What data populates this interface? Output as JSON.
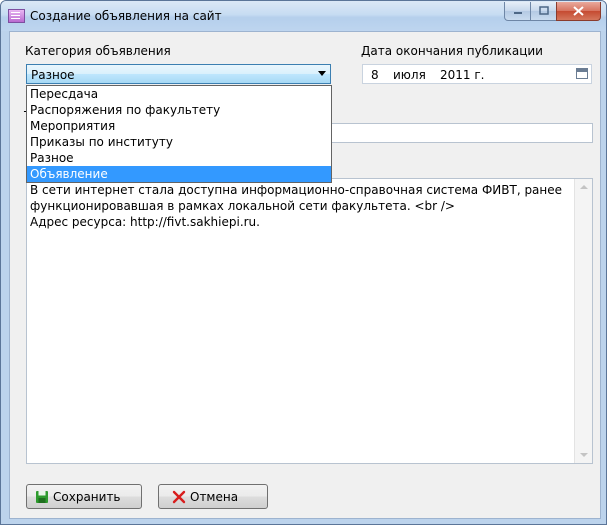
{
  "window": {
    "title": "Создание объявления на сайт"
  },
  "category": {
    "label": "Категория объявления",
    "selected": "Разное",
    "options": [
      "Пересдача",
      "Распоряжения по факультету",
      "Мероприятия",
      "Приказы по институту",
      "Разное",
      "Объявление"
    ],
    "highlighted_index": 5
  },
  "end_date": {
    "label": "Дата окончания публикации",
    "day": "8",
    "month": "июля",
    "year": "2011 г."
  },
  "subject": {
    "label_visible": "Т"
  },
  "body": {
    "text": "В сети интернет стала доступна информационно-справочная система ФИВТ, ранее\nфункционировавшая в рамках локальной сети факультета. <br />\nАдрес ресурса: http://fivt.sakhiepi.ru."
  },
  "buttons": {
    "save": "Сохранить",
    "cancel": "Отмена"
  },
  "colors": {
    "selection": "#3399ff",
    "save_icon": "#2e9b2e",
    "cancel_icon": "#d81e1e"
  }
}
